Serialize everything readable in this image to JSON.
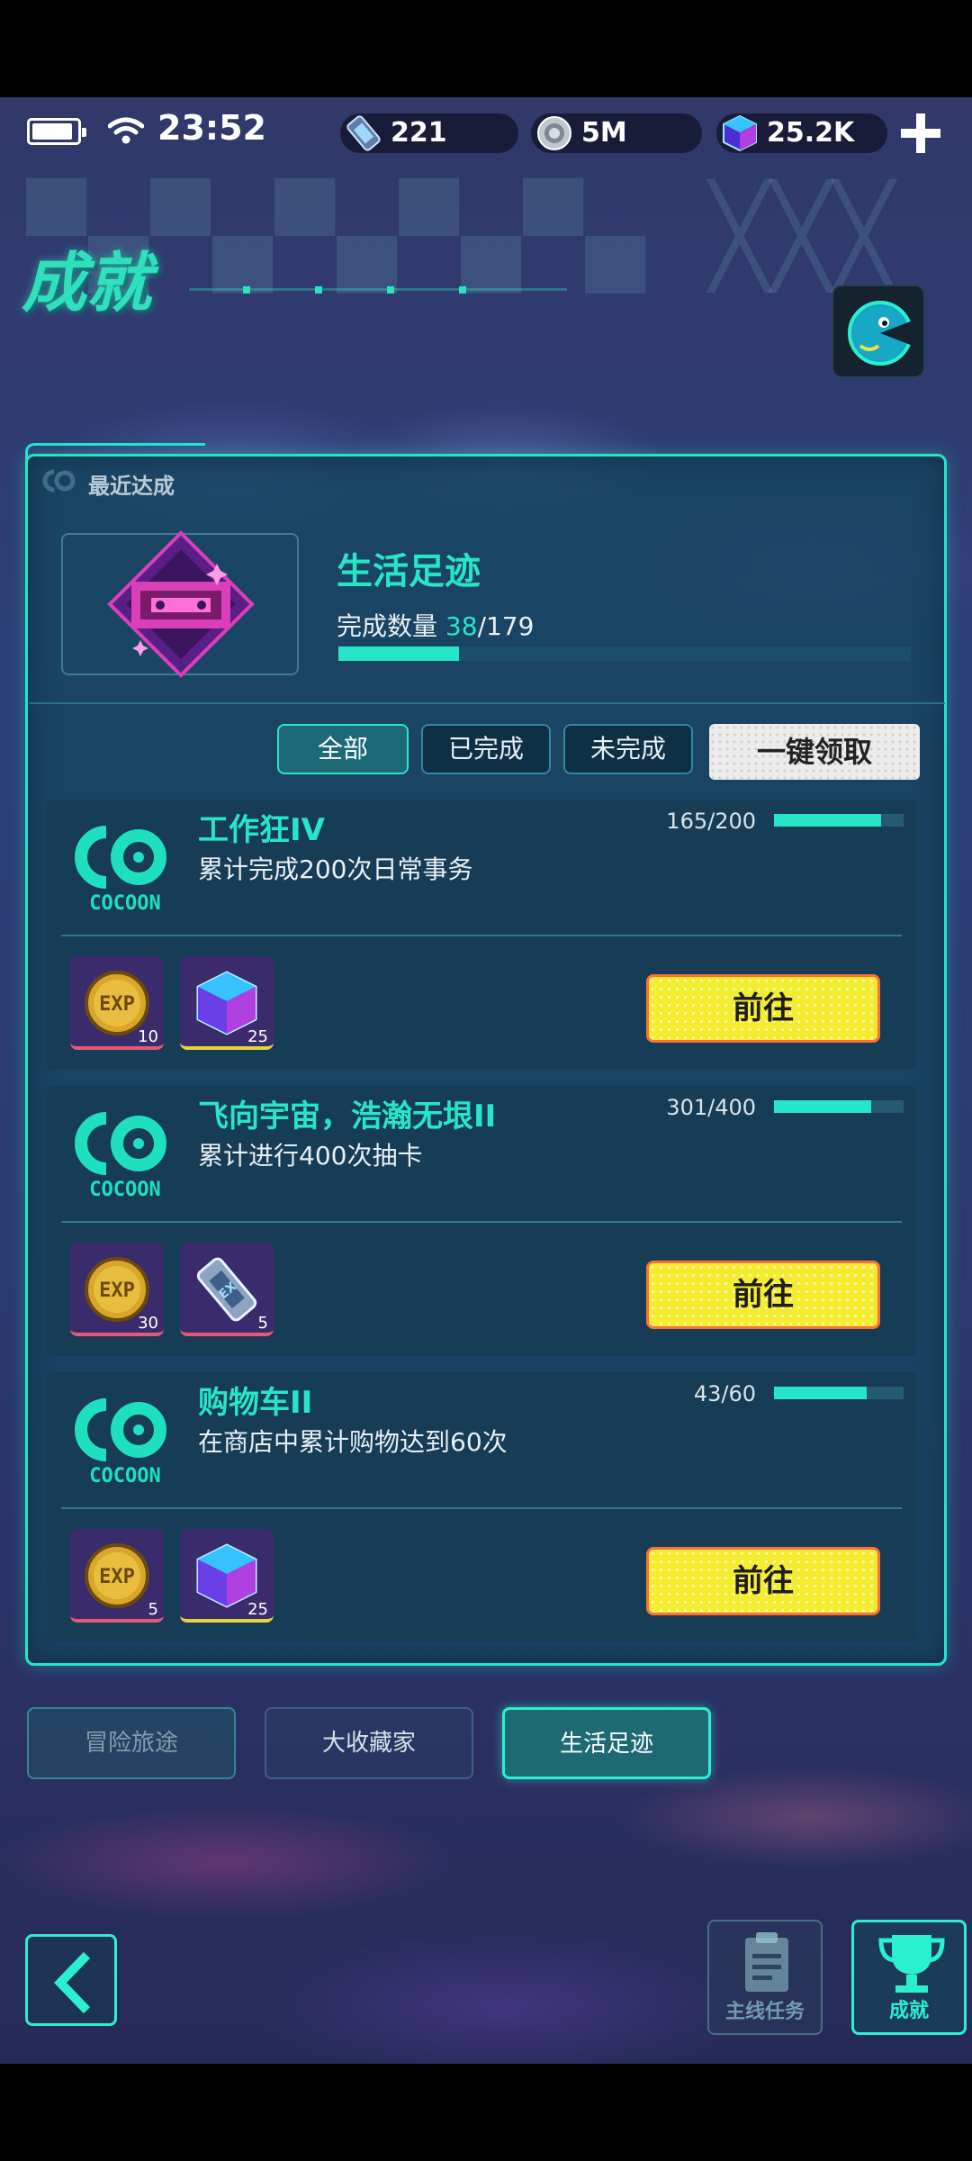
{
  "status_bar": {
    "time": "23:52",
    "resources": [
      {
        "icon": "ticket-icon",
        "value": "221"
      },
      {
        "icon": "coin-icon",
        "value": "5M"
      },
      {
        "icon": "cube-gem-icon",
        "value": "25.2K"
      }
    ]
  },
  "header": {
    "title": "成就"
  },
  "recent": {
    "label": "最近达成",
    "category_title": "生活足迹",
    "count_label": "完成数量",
    "count_current": "38",
    "count_total": "/179",
    "progress_fraction": 0.21
  },
  "filters": {
    "all": "全部",
    "done": "已完成",
    "undone": "未完成",
    "claim_all": "一键领取"
  },
  "achievements": [
    {
      "title": "工作狂IV",
      "desc": "累计完成200次日常事务",
      "progress": "165/200",
      "fraction": 0.825,
      "rewards": [
        {
          "type": "exp",
          "qty": "10"
        },
        {
          "type": "gem",
          "qty": "25"
        }
      ],
      "button": "前往"
    },
    {
      "title": "飞向宇宙，浩瀚无垠II",
      "desc": "累计进行400次抽卡",
      "progress": "301/400",
      "fraction": 0.7525,
      "rewards": [
        {
          "type": "exp",
          "qty": "30"
        },
        {
          "type": "ticket",
          "qty": "5"
        }
      ],
      "button": "前往"
    },
    {
      "title": "购物车II",
      "desc": "在商店中累计购物达到60次",
      "progress": "43/60",
      "fraction": 0.7167,
      "rewards": [
        {
          "type": "exp",
          "qty": "5"
        },
        {
          "type": "gem",
          "qty": "25"
        }
      ],
      "button": "前往"
    }
  ],
  "category_tabs": [
    "冒险旅途",
    "大收藏家",
    "生活足迹"
  ],
  "bottom_nav": {
    "main_quest": "主线任务",
    "achievements": "成就"
  },
  "colors": {
    "accent": "#27e6c7",
    "go_button": "#f4ec2f",
    "badge_pink": "#d93fb8"
  }
}
